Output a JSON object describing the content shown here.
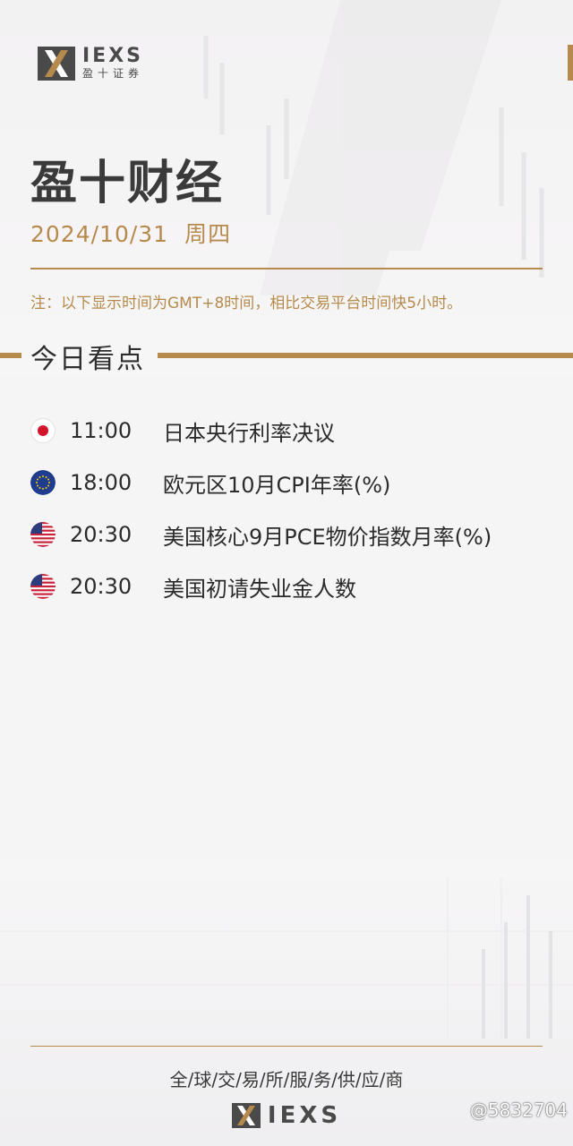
{
  "brand": {
    "name": "IEXS",
    "subtitle": "盈十证券"
  },
  "header": {
    "title": "盈十财经",
    "date": "2024/10/31",
    "weekday": "周四",
    "note": "注：以下显示时间为GMT+8时间，相比交易平台时间快5小时。"
  },
  "section": {
    "title": "今日看点"
  },
  "events": [
    {
      "flag": "japan-flag-icon",
      "time": "11:00",
      "name": "日本央行利率决议"
    },
    {
      "flag": "eu-flag-icon",
      "time": "18:00",
      "name": "欧元区10月CPI年率(%)"
    },
    {
      "flag": "us-flag-icon",
      "time": "20:30",
      "name": "美国核心9月PCE物价指数月率(%)"
    },
    {
      "flag": "us-flag-icon",
      "time": "20:30",
      "name": "美国初请失业金人数"
    }
  ],
  "footer": {
    "slogan": "全/球/交/易/所/服/务/供/应/商",
    "brand": "IEXS",
    "watermark": "@5832704"
  },
  "colors": {
    "accent": "#b58a4c",
    "text": "#2b2b2b",
    "background": "#f6f5f6"
  }
}
